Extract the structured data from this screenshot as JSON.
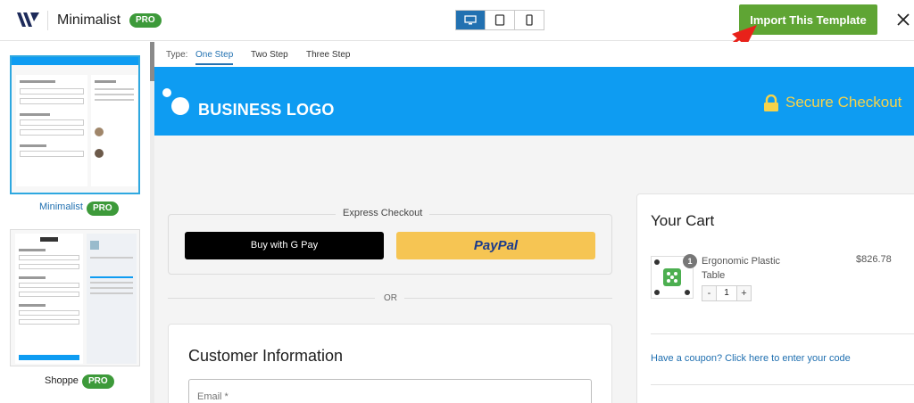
{
  "header": {
    "template_name": "Minimalist",
    "pro_badge": "PRO",
    "import_label": "Import This Template",
    "devices": [
      "desktop-icon",
      "tablet-icon",
      "mobile-icon"
    ],
    "active_device": "desktop"
  },
  "sidebar": {
    "templates": [
      {
        "name": "Minimalist",
        "badge": "PRO",
        "selected": true
      },
      {
        "name": "Shoppe",
        "badge": "PRO",
        "selected": false
      }
    ]
  },
  "type_bar": {
    "label": "Type:",
    "tabs": [
      "One Step",
      "Two Step",
      "Three Step"
    ],
    "active_tab": "One Step"
  },
  "preview": {
    "logo_text": "BUSINESS LOGO",
    "secure_text": "Secure Checkout",
    "express_title": "Express Checkout",
    "gpay_label": "Buy with G Pay",
    "paypal_label": "PayPal",
    "or_text": "OR",
    "customer_title": "Customer Information",
    "email_placeholder": "Email *",
    "cart": {
      "title": "Your Cart",
      "item_name": "Ergonomic Plastic Table",
      "item_price": "$826.78",
      "item_qty_badge": "1",
      "qty_value": "1",
      "minus": "-",
      "plus": "+",
      "coupon_text": "Have a coupon? Click here to enter your code"
    }
  },
  "colors": {
    "accent_blue": "#2271b1",
    "import_green": "#5fa534",
    "banner_blue": "#0e9cf2",
    "secure_yellow": "#f7d34a",
    "paypal_yellow": "#f6c553"
  }
}
